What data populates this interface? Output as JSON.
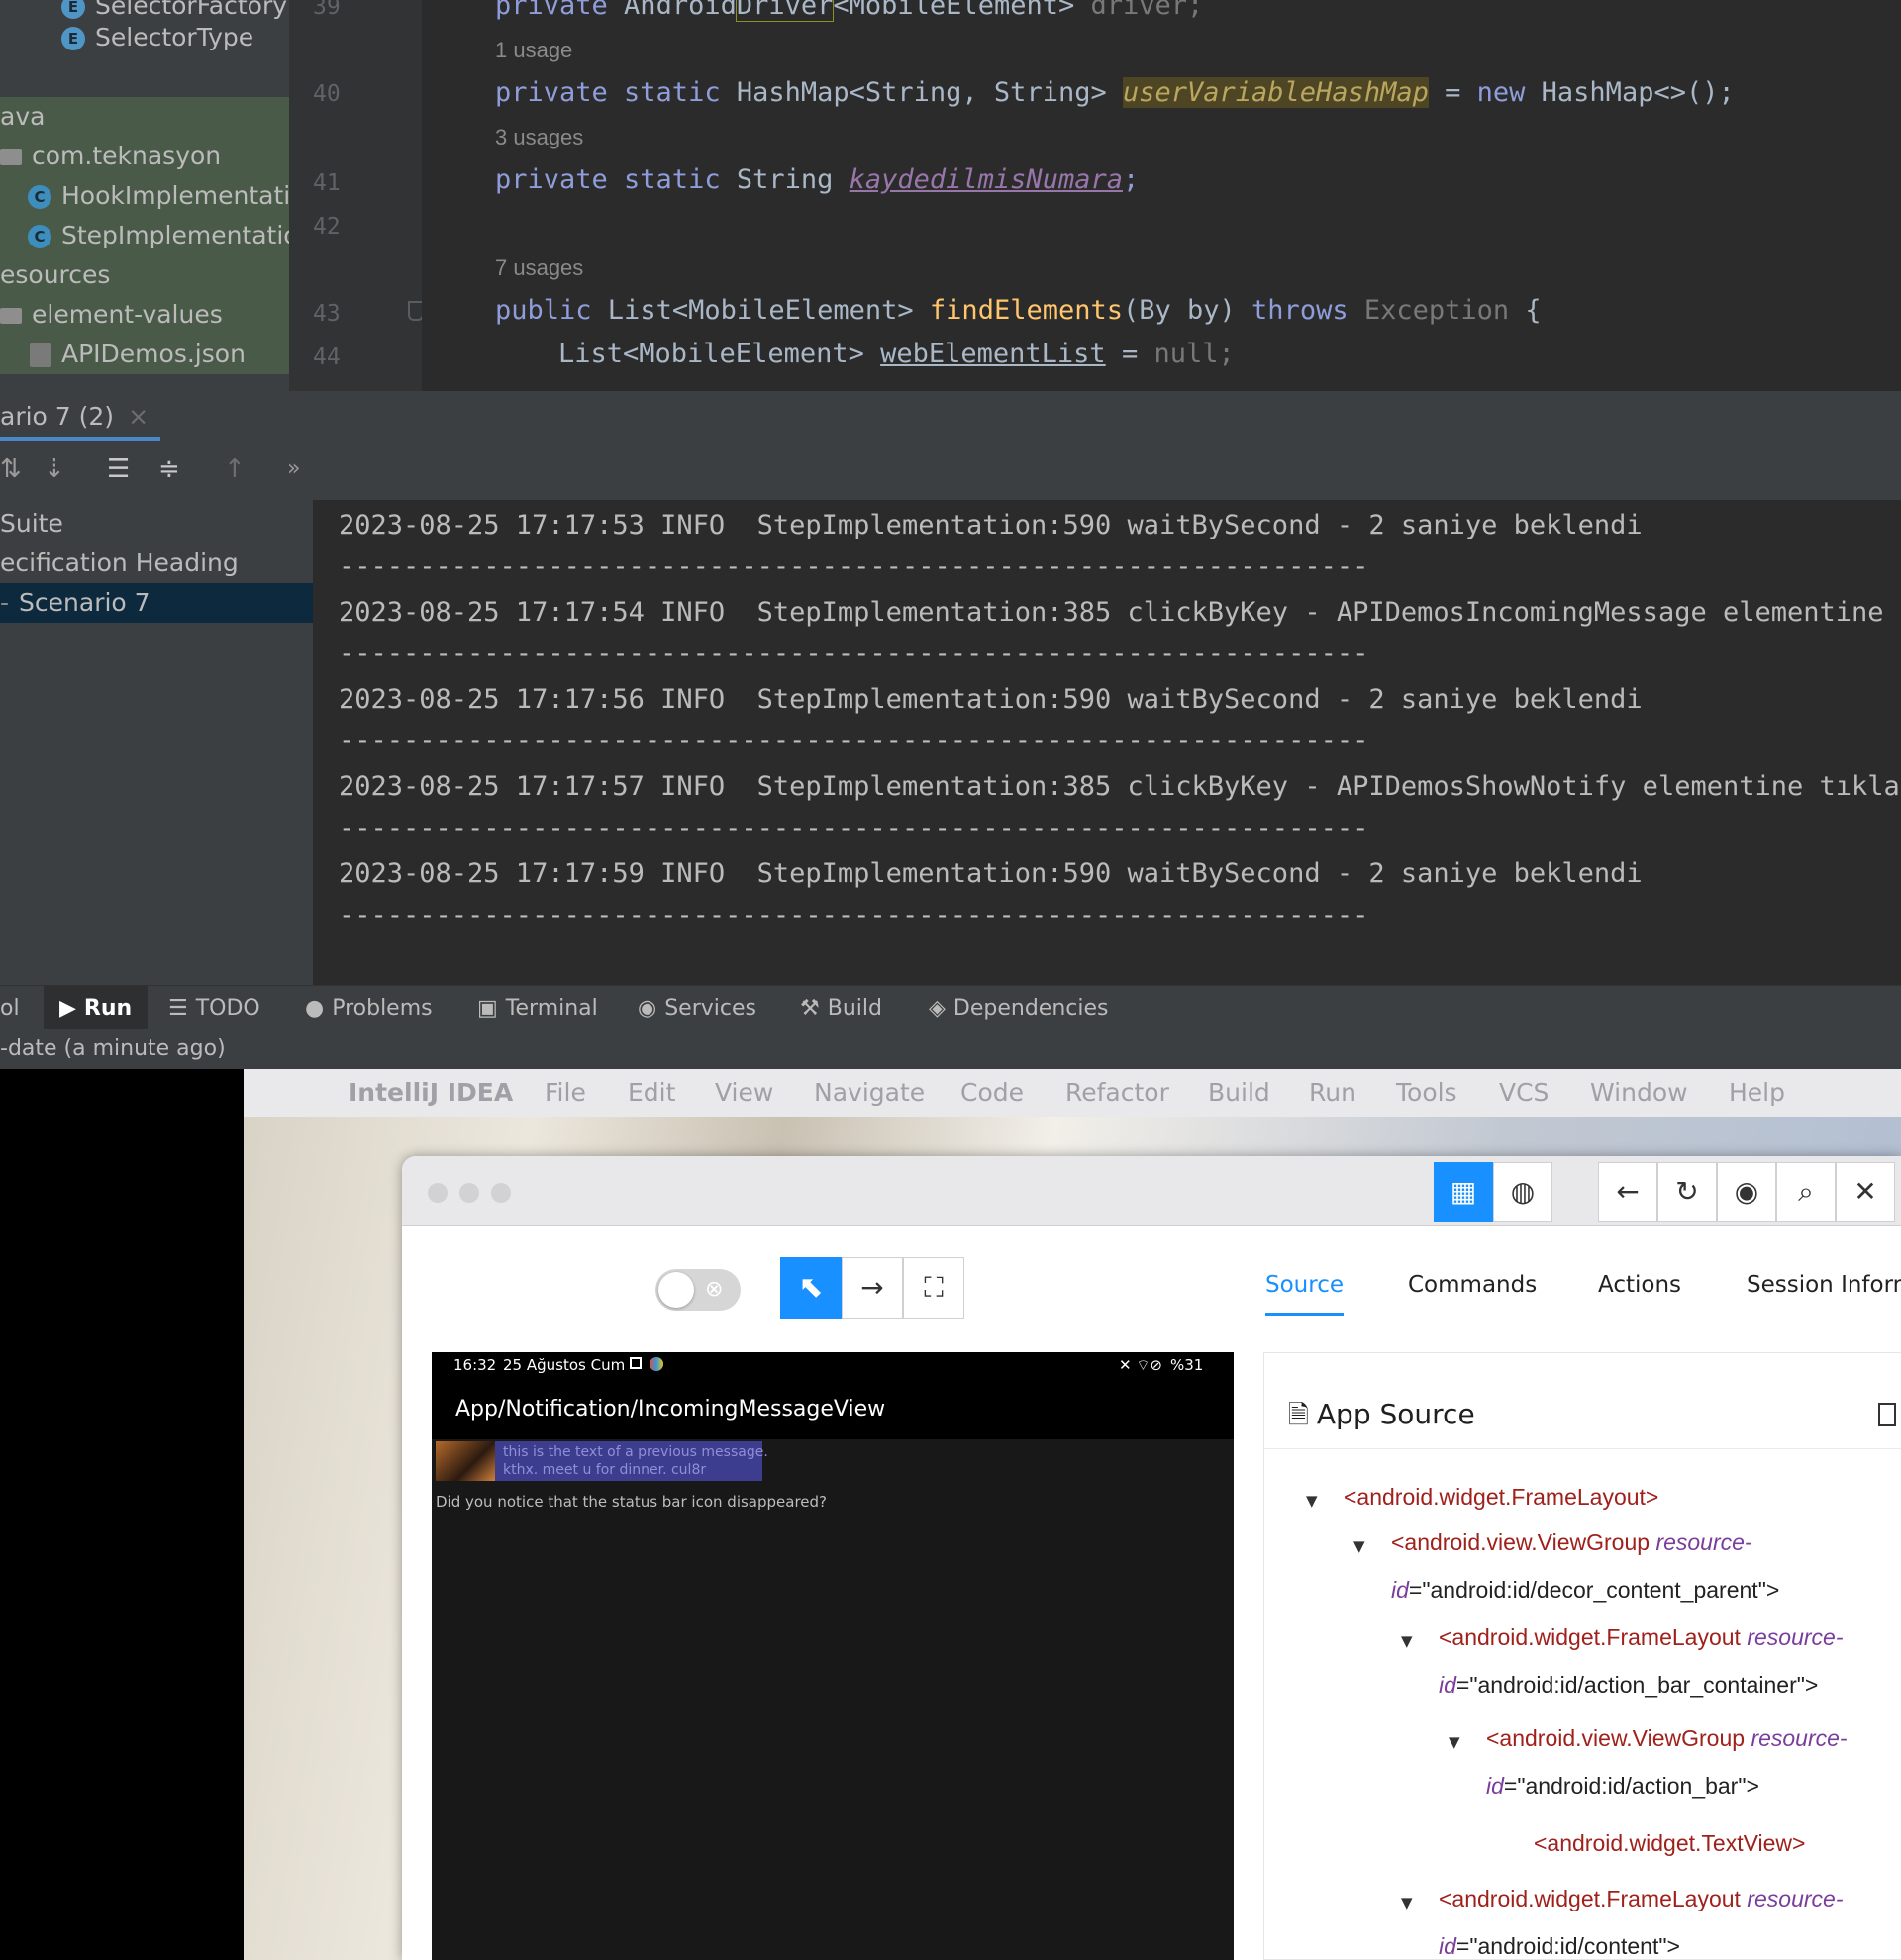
{
  "project_tree": {
    "items": [
      {
        "label": "SelectorFactory",
        "kind": "enum"
      },
      {
        "label": "SelectorType",
        "kind": "enum"
      },
      {
        "label": "ava",
        "kind": "folder"
      },
      {
        "label": "com.teknasyon",
        "kind": "package"
      },
      {
        "label": "HookImplementatio",
        "kind": "class"
      },
      {
        "label": "StepImplementatio",
        "kind": "class"
      },
      {
        "label": "esources",
        "kind": "folder"
      },
      {
        "label": "element-values",
        "kind": "folder"
      },
      {
        "label": "APIDemos.json",
        "kind": "json"
      }
    ]
  },
  "editor": {
    "line_numbers": [
      "39",
      "40",
      "41",
      "42",
      "43",
      "44"
    ],
    "hints": {
      "l40": "1 usage",
      "l41": "3 usages",
      "l43": "7 usages"
    },
    "line39": {
      "kw": "private",
      "type1": " Android",
      "type2": "Driver",
      "type3": "<MobileElement>",
      "rest": " driver;"
    },
    "line40": {
      "kw": "private static",
      "type": " HashMap<String,",
      "type2": " String>",
      "field": "userVariableHashMap",
      "op": " = ",
      "new": "new",
      "rest": " HashMap<>();"
    },
    "line41": {
      "kw": "private static",
      "type": " String ",
      "field": "kaydedilmisNumara",
      "rest": ";"
    },
    "line43": {
      "kw": "public",
      "type": " List<MobileElement> ",
      "fn": "findElements",
      "args": "(By by) ",
      "throws": "throws",
      "exc": " Exception",
      "brace": " {"
    },
    "line44": {
      "type": "List<MobileElement> ",
      "var": "webElementList",
      "op": " = ",
      "null": "null",
      "end": ";"
    }
  },
  "run_panel": {
    "tab_label": "ario 7 (2)",
    "tree": [
      {
        "label": "Suite"
      },
      {
        "label": "ecification Heading"
      },
      {
        "label": "Scenario 7",
        "selected": true
      }
    ],
    "log_lines": [
      "2023-08-25 17:17:53 INFO  StepImplementation:590 waitBySecond - 2 saniye beklendi",
      "2023-08-25 17:17:54 INFO  StepImplementation:385 clickByKey - APIDemosIncomingMessage elementine tı",
      "2023-08-25 17:17:56 INFO  StepImplementation:590 waitBySecond - 2 saniye beklendi",
      "2023-08-25 17:17:57 INFO  StepImplementation:385 clickByKey - APIDemosShowNotify elementine tıkladı",
      "2023-08-25 17:17:59 INFO  StepImplementation:590 waitBySecond - 2 saniye beklendi"
    ],
    "separator": "----------------------------------------------------------------"
  },
  "bottom_tabs": {
    "ol": "ol",
    "run": "Run",
    "todo": "TODO",
    "problems": "Problems",
    "terminal": "Terminal",
    "services": "Services",
    "build": "Build",
    "dependencies": "Dependencies"
  },
  "status_text": "-date (a minute ago)",
  "mac_menu": {
    "app": "IntelliJ IDEA",
    "items": [
      "File",
      "Edit",
      "View",
      "Navigate",
      "Code",
      "Refactor",
      "Build",
      "Run",
      "Tools",
      "VCS",
      "Window",
      "Help"
    ]
  },
  "inspector": {
    "tabs": [
      "Source",
      "Commands",
      "Actions",
      "Session Inform"
    ],
    "active_tab": "Source",
    "phone": {
      "time": "16:32",
      "date": "25 Ağustos Cum",
      "battery": "%31",
      "title": "App/Notification/IncomingMessageView",
      "msg1": "this is the text of a previous message.",
      "msg2": "kthx. meet u for dinner. cul8r",
      "body": "Did you notice that the status bar icon disappeared?"
    },
    "source_title": "App Source",
    "xml": {
      "n1": "<android.widget.FrameLayout>",
      "n2_tag": "<android.view.ViewGroup",
      "n2_attr": "resource-",
      "n2b_attr": "id",
      "n2b_val": "=\"android:id/decor_content_parent\">",
      "n3_tag": "<android.widget.FrameLayout",
      "n3_attr": "resource-",
      "n3b_attr": "id",
      "n3b_val": "=\"android:id/action_bar_container\">",
      "n4_tag": "<android.view.ViewGroup",
      "n4_attr": "resource-",
      "n4b_attr": "id",
      "n4b_val": "=\"android:id/action_bar\">",
      "n5": "<android.widget.TextView>",
      "n6_tag": "<android.widget.FrameLayout",
      "n6_attr": "resource-",
      "n6b_attr": "id",
      "n6b_val": "=\"android:id/content\">"
    }
  },
  "colors": {
    "accent": "#1890ff",
    "ide_bg": "#2b2b2b",
    "ide_panel": "#3c3f41",
    "xml_tag": "#a0211c",
    "xml_attr": "#7b3d9c"
  }
}
